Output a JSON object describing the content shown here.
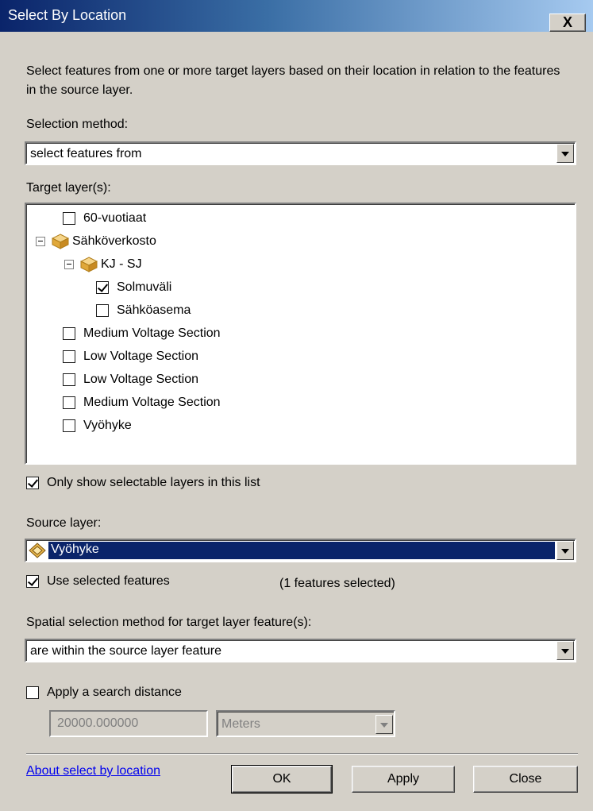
{
  "window": {
    "title": "Select By Location",
    "close_label": "X"
  },
  "description": "Select features from one or more target layers based on their location in relation to the features in the source layer.",
  "selection_method": {
    "label": "Selection method:",
    "value": "select features from"
  },
  "target_layers": {
    "label": "Target layer(s):",
    "items": [
      {
        "label": "60-vuotiaat",
        "checked": false
      },
      {
        "label": "Sähköverkosto",
        "group": true,
        "expanded": true
      },
      {
        "label": "KJ - SJ",
        "group": true,
        "expanded": true
      },
      {
        "label": "Solmuväli",
        "checked": true
      },
      {
        "label": "Sähköasema",
        "checked": false
      },
      {
        "label": "Medium Voltage Section",
        "checked": false
      },
      {
        "label": "Low Voltage Section",
        "checked": false
      },
      {
        "label": "Low Voltage Section",
        "checked": false
      },
      {
        "label": "Medium Voltage Section",
        "checked": false
      },
      {
        "label": "Vyöhyke",
        "checked": false
      }
    ]
  },
  "only_selectable": {
    "label": "Only show selectable layers in this list",
    "checked": true
  },
  "source_layer": {
    "label": "Source layer:",
    "value": "Vyöhyke",
    "icon": "polygon-layer-icon"
  },
  "use_selected": {
    "label": "Use selected features",
    "checked": true,
    "count_text": "(1 features selected)"
  },
  "spatial_method": {
    "label": "Spatial selection method for target layer feature(s):",
    "value": "are within the source layer feature"
  },
  "search_distance": {
    "label": "Apply a search distance",
    "checked": false,
    "value": "20000.000000",
    "unit": "Meters"
  },
  "footer": {
    "help_link": "About select by location",
    "ok_label": "OK",
    "apply_label": "Apply",
    "close_label": "Close"
  },
  "colors": {
    "title_start": "#0a246a",
    "title_end": "#a6caf0",
    "selection": "#0a246a",
    "face": "#d4d0c8",
    "link": "#0000ee"
  }
}
